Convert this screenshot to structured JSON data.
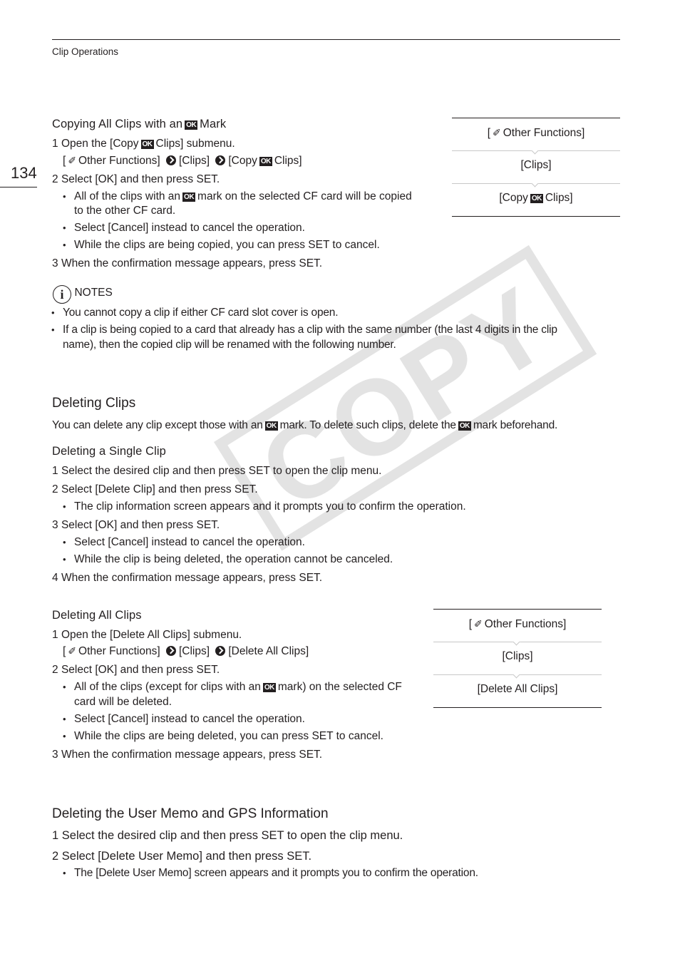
{
  "header": {
    "section_title": "Clip Operations",
    "page_number": "134"
  },
  "watermark": "COPY",
  "copy_ok": {
    "title_pre": "Copying All Clips with an",
    "title_post": "Mark",
    "step1": {
      "num": "1",
      "pre": "Open the [Copy",
      "post": "Clips] submenu."
    },
    "path": {
      "other": "Other Functions]",
      "open_bracket": "[",
      "clips": "[Clips]",
      "copy_pre": "[Copy",
      "copy_post": "Clips]"
    },
    "step2": {
      "num": "2",
      "text": "Select [OK] and then press SET."
    },
    "bullets": [
      {
        "pre": "All of the clips with an",
        "post": "mark on the selected CF card will be copied",
        "cont": "to the other CF card."
      },
      {
        "text": "Select [Cancel] instead to cancel the operation."
      },
      {
        "text": "While the clips are being copied, you can press SET to cancel."
      }
    ],
    "step3": {
      "num": "3",
      "text": "When the confirmation message appears, press SET."
    },
    "menu": [
      "Other Functions]",
      "[Clips]",
      "[Copy",
      "Clips]"
    ]
  },
  "ok_icon": "OK",
  "wrench_icon": "✐",
  "notes": {
    "label": "NOTES",
    "icon": "i",
    "items": [
      "You cannot copy a clip if either CF card slot cover is open.",
      "If a clip is being copied to a card that already has a clip with the same number (the last 4 digits in the clip",
      "name), then the copied clip will be renamed with the following number."
    ]
  },
  "deleting": {
    "title": "Deleting Clips",
    "intro_a": "You can delete any clip except those with an",
    "intro_b": "mark. To delete such clips, delete the",
    "intro_c": "mark beforehand.",
    "single": {
      "title": "Deleting a Single Clip",
      "steps": [
        {
          "num": "1",
          "text": "Select the desired clip and then press SET to open the clip menu."
        },
        {
          "num": "2",
          "text": "Select [Delete Clip] and then press SET."
        },
        {
          "bullet": "The clip information screen appears and it prompts you to confirm the operation."
        },
        {
          "num": "3",
          "text": "Select [OK] and then press SET."
        },
        {
          "bullet": "Select [Cancel] instead to cancel the operation."
        },
        {
          "bullet": "While the clip is being deleted, the operation cannot be canceled."
        },
        {
          "num": "4",
          "text": "When the confirmation message appears, press SET."
        }
      ]
    },
    "all": {
      "title": "Deleting All Clips",
      "step1": {
        "num": "1",
        "text": "Open the [Delete All Clips] submenu."
      },
      "path": {
        "open_bracket": "[",
        "other": "Other Functions]",
        "clips": "[Clips]",
        "delete_all": "[Delete All Clips]"
      },
      "step2": {
        "num": "2",
        "text": "Select [OK] and then press SET."
      },
      "bullets": [
        {
          "pre": "All of the clips (except for clips with an",
          "post": "mark) on the selected CF",
          "cont": "card will be deleted."
        },
        {
          "text": "Select [Cancel] instead to cancel the operation."
        },
        {
          "text": "While the clips are being deleted, you can press SET to cancel."
        }
      ],
      "step3": {
        "num": "3",
        "text": "When the confirmation message appears, press SET."
      },
      "menu": [
        "Other Functions]",
        "[Clips]",
        "[Delete All Clips]"
      ]
    }
  },
  "memo": {
    "title": "Deleting the User Memo and GPS Information",
    "step1": {
      "num": "1",
      "text": "Select the desired clip and then press SET to open the clip menu."
    },
    "step2": {
      "num": "2",
      "text": "Select [Delete User Memo] and then press SET."
    },
    "bullet": "The [Delete User Memo] screen appears and it prompts you to confirm the operation."
  }
}
